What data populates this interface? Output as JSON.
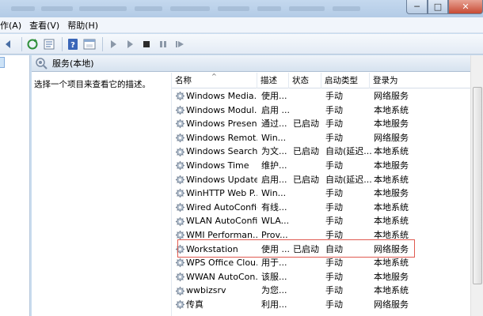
{
  "window": {
    "min_symbol": "─",
    "max_symbol": "□",
    "close_symbol": "✕"
  },
  "menubar": {
    "items": [
      "作(A)",
      "查看(V)",
      "帮助(H)"
    ]
  },
  "toolbar": {
    "icons": [
      "back-arrow-icon",
      "refresh-icon",
      "export-list-icon",
      "help-icon",
      "properties-icon",
      "play-icon",
      "play-alt-icon",
      "stop-icon",
      "pause-icon",
      "restart-icon"
    ]
  },
  "services_header": {
    "title": "服务(本地)"
  },
  "description_pane": {
    "text": "选择一个项目来查看它的描述。"
  },
  "columns": {
    "name": "名称",
    "desc": "描述",
    "status": "状态",
    "startup": "启动类型",
    "logon": "登录为"
  },
  "rows": [
    {
      "name": "Windows Media...",
      "desc": "使用...",
      "status": "",
      "startup": "手动",
      "logon": "网络服务"
    },
    {
      "name": "Windows Modul...",
      "desc": "启用 ...",
      "status": "",
      "startup": "手动",
      "logon": "本地系统"
    },
    {
      "name": "Windows Presen...",
      "desc": "通过...",
      "status": "已启动",
      "startup": "手动",
      "logon": "本地服务"
    },
    {
      "name": "Windows Remot...",
      "desc": "Win...",
      "status": "",
      "startup": "手动",
      "logon": "网络服务"
    },
    {
      "name": "Windows Search",
      "desc": "为文...",
      "status": "已启动",
      "startup": "自动(延迟...",
      "logon": "本地系统"
    },
    {
      "name": "Windows Time",
      "desc": "维护...",
      "status": "",
      "startup": "手动",
      "logon": "本地服务"
    },
    {
      "name": "Windows Update",
      "desc": "启用...",
      "status": "已启动",
      "startup": "自动(延迟...",
      "logon": "本地系统"
    },
    {
      "name": "WinHTTP Web P...",
      "desc": "Win...",
      "status": "",
      "startup": "手动",
      "logon": "本地服务"
    },
    {
      "name": "Wired AutoConfig",
      "desc": "有线...",
      "status": "",
      "startup": "手动",
      "logon": "本地系统"
    },
    {
      "name": "WLAN AutoConfig",
      "desc": "WLA...",
      "status": "",
      "startup": "手动",
      "logon": "本地系统"
    },
    {
      "name": "WMI Performan...",
      "desc": "Prov...",
      "status": "",
      "startup": "手动",
      "logon": "本地系统"
    },
    {
      "name": "Workstation",
      "desc": "使用 ...",
      "status": "已启动",
      "startup": "自动",
      "logon": "网络服务"
    },
    {
      "name": "WPS Office Clou...",
      "desc": "用于...",
      "status": "",
      "startup": "手动",
      "logon": "本地系统"
    },
    {
      "name": "WWAN AutoCon...",
      "desc": "该服...",
      "status": "",
      "startup": "手动",
      "logon": "本地服务"
    },
    {
      "name": "wwbizsrv",
      "desc": "为您...",
      "status": "",
      "startup": "手动",
      "logon": "本地系统"
    },
    {
      "name": "传真",
      "desc": "利用...",
      "status": "",
      "startup": "手动",
      "logon": "网络服务"
    }
  ],
  "highlight": {
    "color": "#e05a50"
  }
}
